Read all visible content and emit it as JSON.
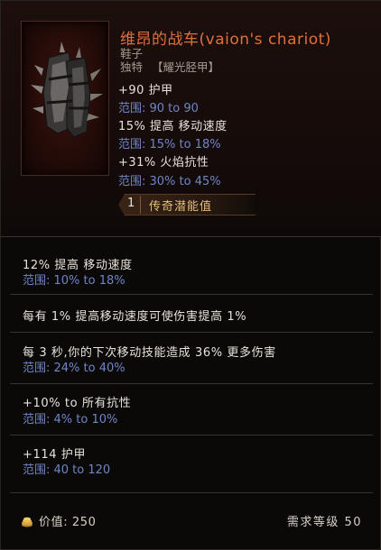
{
  "item": {
    "name": "维昂的战车(vaion's chariot)",
    "type": "鞋子",
    "rarity_prefix": "独特",
    "base_type": "【耀光胫甲】",
    "implicits": [
      {
        "text": "+90 护甲",
        "range": "范围: 90 to 90"
      },
      {
        "text": "15% 提高 移动速度",
        "range": "范围: 15% to 18%"
      },
      {
        "text": "+31% 火焰抗性",
        "range": "范围: 30% to 45%"
      }
    ],
    "legendary_potential": {
      "count": "1",
      "label": "传奇潜能值"
    }
  },
  "affixes": [
    {
      "text": "12% 提高 移动速度",
      "range": "范围: 10% to 18%"
    },
    {
      "text": "每有 1% 提高移动速度可使伤害提高 1%",
      "range": ""
    },
    {
      "text": "每 3 秒,你的下次移动技能造成 36% 更多伤害",
      "range": "范围: 24% to 40%"
    },
    {
      "text": "+10% to 所有抗性",
      "range": "范围: 4% to 10%"
    },
    {
      "text": "+114 护甲",
      "range": "范围: 40 to 120"
    }
  ],
  "footer": {
    "value_label": "价值: 250",
    "level_label": "需求等级 50"
  },
  "colors": {
    "title": "#e16f3d",
    "stat": "#e8e2da",
    "range": "#6f86c6",
    "potential": "#e3c07a"
  },
  "icons": {
    "item": "spiked-greaves-icon",
    "currency": "gold-coin-icon"
  }
}
